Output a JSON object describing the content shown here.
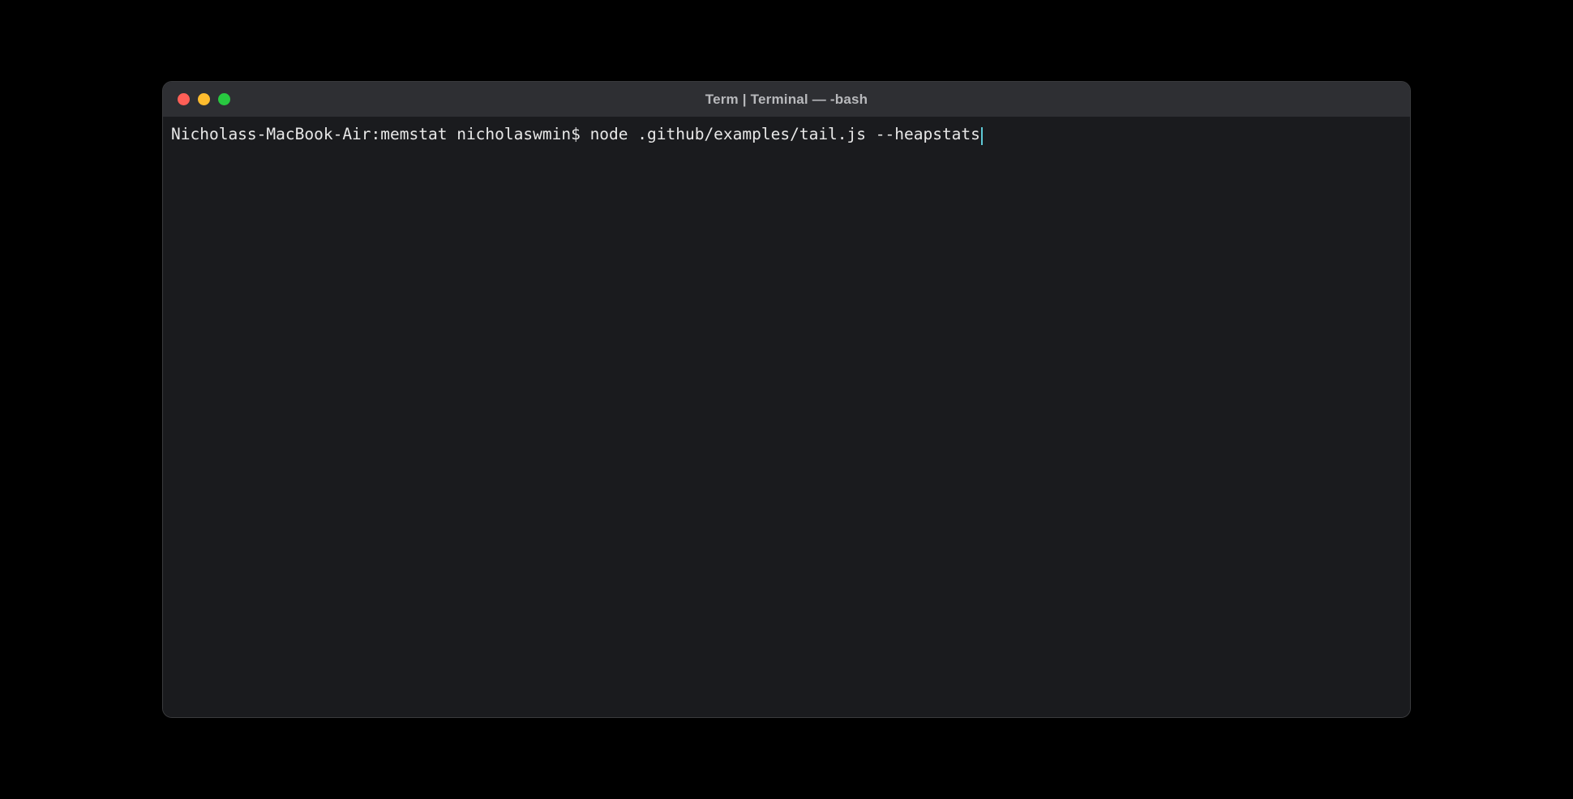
{
  "window": {
    "title": "Term | Terminal — -bash"
  },
  "traffic_lights": {
    "close_color": "#ff5f57",
    "minimize_color": "#febc2e",
    "zoom_color": "#28c840"
  },
  "terminal": {
    "prompt": "Nicholass-MacBook-Air:memstat nicholaswmin$ ",
    "command": "node .github/examples/tail.js --heapstats",
    "cursor_color": "#5ec9d6"
  }
}
